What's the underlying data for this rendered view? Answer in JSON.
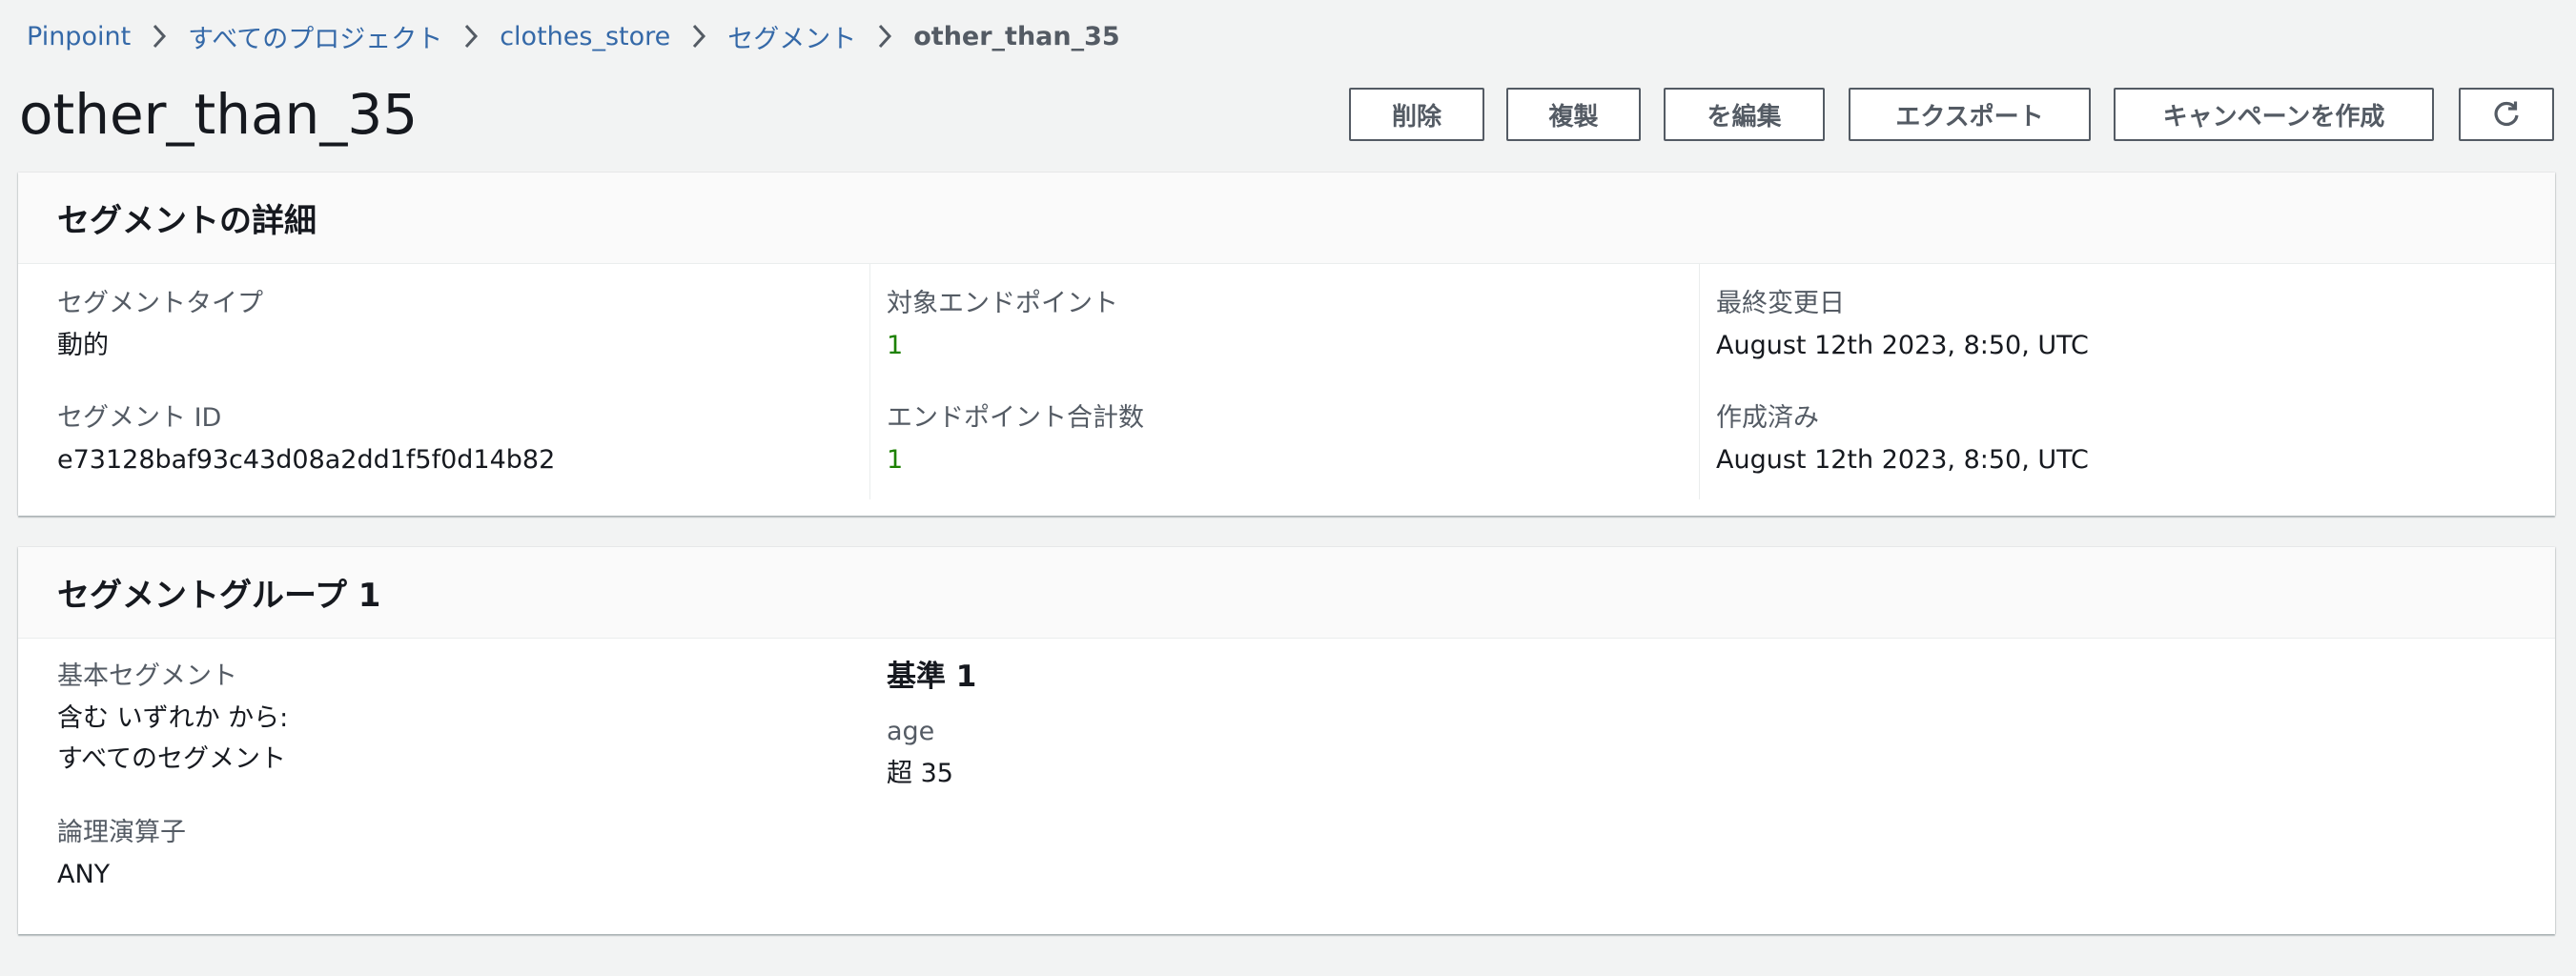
{
  "breadcrumb": {
    "items": [
      "Pinpoint",
      "すべてのプロジェクト",
      "clothes_store",
      "セグメント"
    ],
    "current": "other_than_35"
  },
  "page": {
    "title": "other_than_35"
  },
  "actions": {
    "delete": "削除",
    "duplicate": "複製",
    "edit": "を編集",
    "export": "エクスポート",
    "create_campaign": "キャンペーンを作成",
    "refresh_icon": "refresh-icon"
  },
  "details": {
    "title": "セグメントの詳細",
    "segment_type_label": "セグメントタイプ",
    "segment_type_value": "動的",
    "segment_id_label": "セグメント ID",
    "segment_id_value": "e73128baf93c43d08a2dd1f5f0d14b82",
    "target_endpoints_label": "対象エンドポイント",
    "target_endpoints_value": "1",
    "total_endpoints_label": "エンドポイント合計数",
    "total_endpoints_value": "1",
    "last_modified_label": "最終変更日",
    "last_modified_value": "August 12th 2023, 8:50, UTC",
    "created_label": "作成済み",
    "created_value": "August 12th 2023, 8:50, UTC"
  },
  "group": {
    "title": "セグメントグループ 1",
    "base_segment_label": "基本セグメント",
    "base_segment_line1": "含む いずれか から:",
    "base_segment_line2": "すべてのセグメント",
    "logical_operator_label": "論理演算子",
    "logical_operator_value": "ANY",
    "criteria_title": "基準 1",
    "criteria_attribute": "age",
    "criteria_value": "超 35"
  },
  "colors": {
    "link": "#3569a8",
    "background": "#f2f3f3",
    "success": "#1d8102",
    "button_border": "#545b64"
  }
}
